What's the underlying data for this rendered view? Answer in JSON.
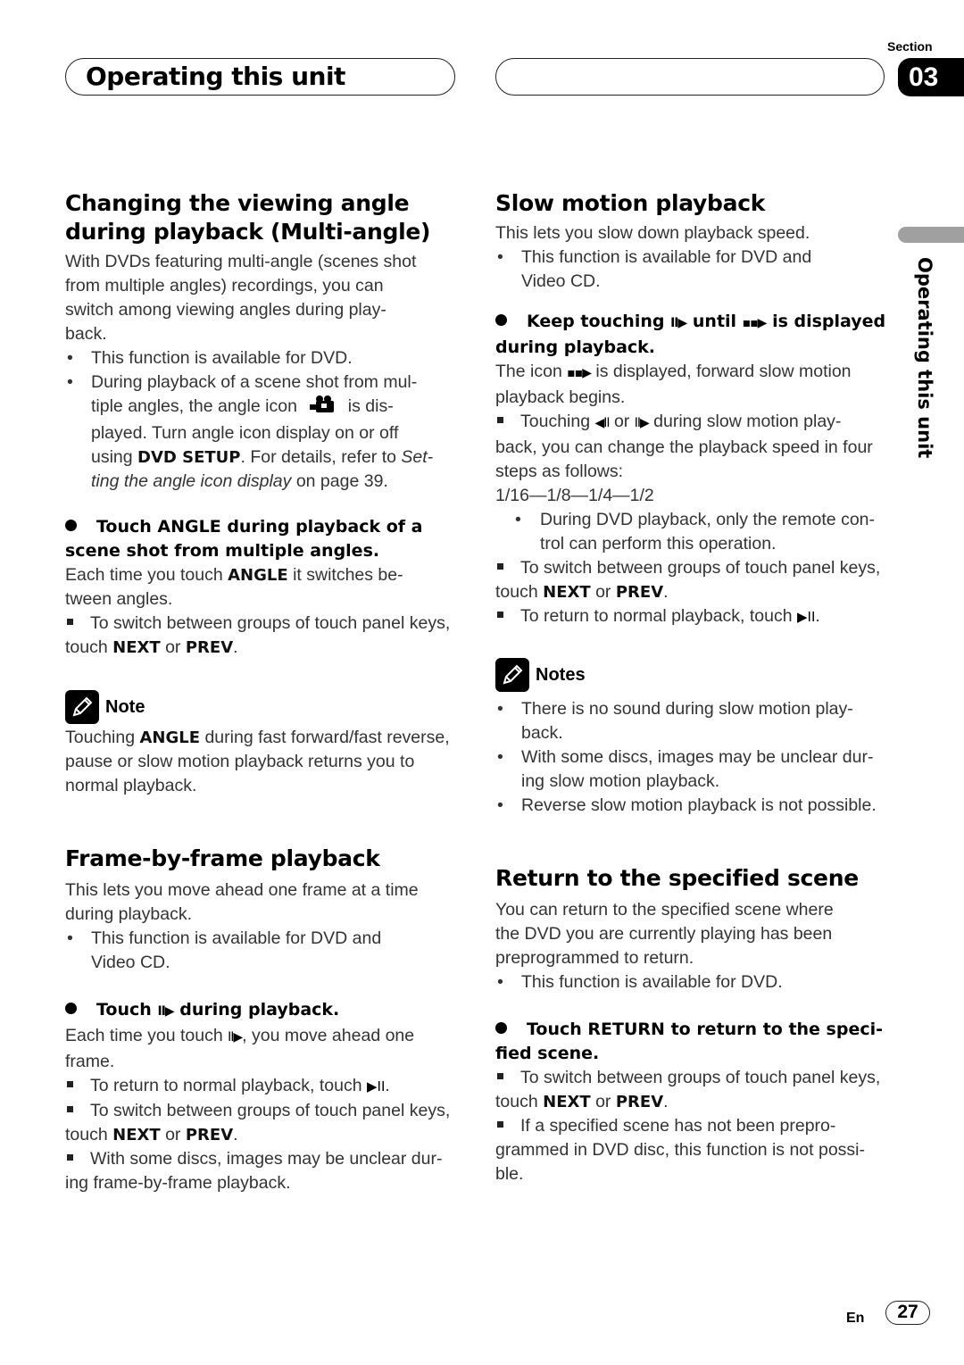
{
  "header": {
    "title": "Operating this unit",
    "section_label": "Section",
    "section_number": "03",
    "side_tab": "Operating this unit"
  },
  "left": {
    "angle": {
      "title_line1": "Changing the viewing angle",
      "title_line2": "during playback (Multi-angle)",
      "intro": [
        "With DVDs featuring multi-angle (scenes shot",
        "from multiple angles) recordings, you can",
        "switch among viewing angles during play-",
        "back."
      ],
      "bullet1": "This function is available for DVD.",
      "bullet2_l1": "During playback of a scene shot from mul-",
      "bullet2_l2a": "tiple angles, the angle icon",
      "bullet2_l2b": "is dis-",
      "bullet2_l3": "played. Turn angle icon display on or off",
      "bullet2_l4a": "using",
      "bullet2_l4b": "DVD SETUP",
      "bullet2_l4c": ". For details, refer to",
      "bullet2_l4d": "Set-",
      "bullet2_l5a": "ting the angle icon display",
      "bullet2_l5b": "on page 39.",
      "step_l1": "Touch ANGLE during playback of a",
      "step_l2": "scene shot from multiple angles.",
      "desc_l1a": "Each time you touch",
      "desc_l1b": "ANGLE",
      "desc_l1c": "it switches be-",
      "desc_l2": "tween angles.",
      "sq1_l1": "To switch between groups of touch panel keys,",
      "sq1_l2a": "touch",
      "sq1_l2b": "NEXT",
      "sq1_l2c": "or",
      "sq1_l2d": "PREV",
      "sq1_l2e": "."
    },
    "note": {
      "label": "Note",
      "l1a": "Touching",
      "l1b": "ANGLE",
      "l1c": "during fast forward/fast reverse,",
      "l2": "pause or slow motion playback returns you to",
      "l3": "normal playback."
    },
    "frame": {
      "title": "Frame-by-frame playback",
      "intro": [
        "This lets you move ahead one frame at a time",
        "during playback."
      ],
      "bullet1_l1": "This function is available for DVD and",
      "bullet1_l2": "Video CD.",
      "step_a": "Touch",
      "step_b": "during playback.",
      "desc_l1a": "Each time you touch",
      "desc_l1b": ", you move ahead one",
      "desc_l2": "frame.",
      "sq1": "To return to normal playback, touch",
      "sq2_l1": "To switch between groups of touch panel keys,",
      "sq2_l2a": "touch",
      "sq2_l2b": "NEXT",
      "sq2_l2c": "or",
      "sq2_l2d": "PREV",
      "sq2_l2e": ".",
      "sq3_l1": "With some discs, images may be unclear dur-",
      "sq3_l2": "ing frame-by-frame playback."
    }
  },
  "right": {
    "slow": {
      "title": "Slow motion playback",
      "intro": "This lets you slow down playback speed.",
      "bullet1_l1": "This function is available for DVD and",
      "bullet1_l2": "Video CD.",
      "step_a": "Keep touching",
      "step_b": "until",
      "step_c": "is displayed",
      "step_l2": "during playback.",
      "desc_l1a": "The icon",
      "desc_l1b": "is displayed, forward slow motion",
      "desc_l2": "playback begins.",
      "sq1_l1a": "Touching",
      "sq1_l1b": "or",
      "sq1_l1c": "during slow motion play-",
      "sq1_l2": "back, you can change the playback speed in four",
      "sq1_l3": "steps as follows:",
      "speeds": "1/16—1/8—1/4—1/2",
      "sub_l1": "During DVD playback, only the remote con-",
      "sub_l2": "trol can perform this operation.",
      "sq2_l1": "To switch between groups of touch panel keys,",
      "sq2_l2a": "touch",
      "sq2_l2b": "NEXT",
      "sq2_l2c": "or",
      "sq2_l2d": "PREV",
      "sq2_l2e": ".",
      "sq3": "To return to normal playback, touch"
    },
    "notes": {
      "label": "Notes",
      "n1_l1": "There is no sound during slow motion play-",
      "n1_l2": "back.",
      "n2_l1": "With some discs, images may be unclear dur-",
      "n2_l2": "ing slow motion playback.",
      "n3": "Reverse slow motion playback is not possible."
    },
    "ret": {
      "title": "Return to the specified scene",
      "intro": [
        "You can return to the specified scene where",
        "the DVD you are currently playing has been",
        "preprogrammed to return."
      ],
      "bullet1": "This function is available for DVD.",
      "step_l1": "Touch RETURN to return to the speci-",
      "step_l2": "fied scene.",
      "sq1_l1": "To switch between groups of touch panel keys,",
      "sq1_l2a": "touch",
      "sq1_l2b": "NEXT",
      "sq1_l2c": "or",
      "sq1_l2d": "PREV",
      "sq1_l2e": ".",
      "sq2_l1": "If a specified scene has not been prepro-",
      "sq2_l2": "grammed in DVD disc, this function is not possi-",
      "sq2_l3": "ble."
    }
  },
  "icons": {
    "step_forward": "II▶",
    "step_reverse": "◀II",
    "slow_indicator": "▪▪▶",
    "play_pause": "▶II"
  },
  "footer": {
    "lang": "En",
    "page": "27"
  }
}
